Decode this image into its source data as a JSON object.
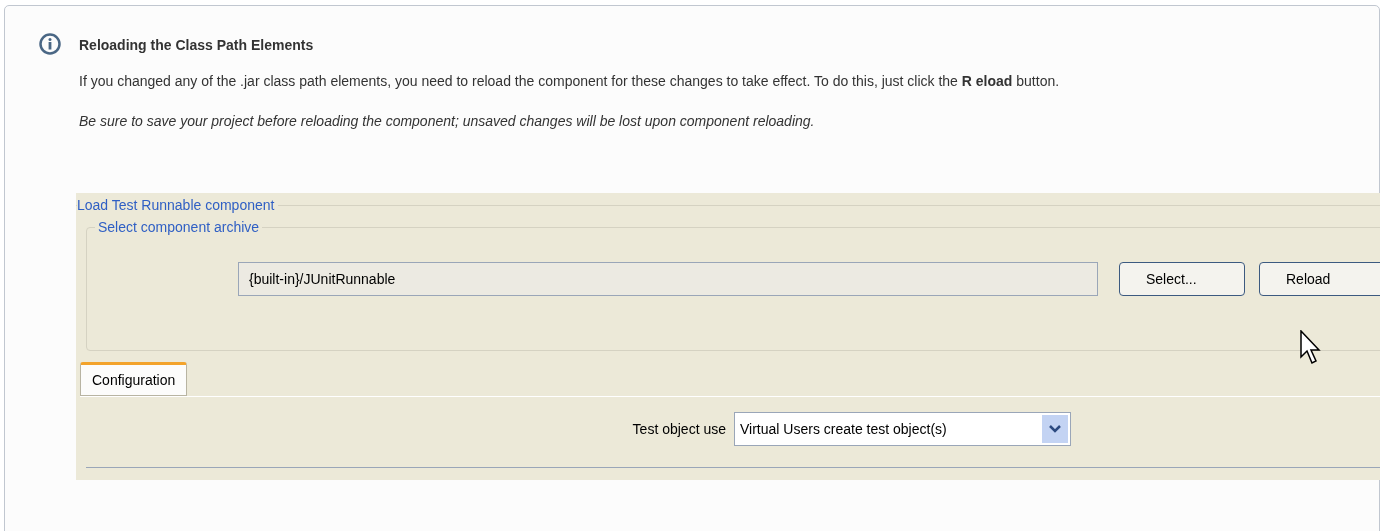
{
  "note": {
    "title": "Reloading the Class Path Elements",
    "paragraphs": [
      {
        "kind": "plain",
        "text": "If you changed any of the .jar class path elements, you need to reload the component for these changes to take effect. To do this, just click the **R eload** button."
      },
      {
        "kind": "italic",
        "text": "Be sure to save your project before reloading the component; unsaved changes will be lost upon component reloading."
      }
    ]
  },
  "screenshot": {
    "section_title": "Load Test Runnable component",
    "group_title": "Select component archive",
    "archive_field": {
      "value": "{built-in}/JUnitRunnable"
    },
    "buttons": [
      "Select...",
      "Reload"
    ],
    "tabs": [
      {
        "label": "Configuration",
        "selected": true
      }
    ],
    "test_object_use": {
      "label": "Test object use",
      "value": "Virtual Users create test object(s)"
    }
  }
}
